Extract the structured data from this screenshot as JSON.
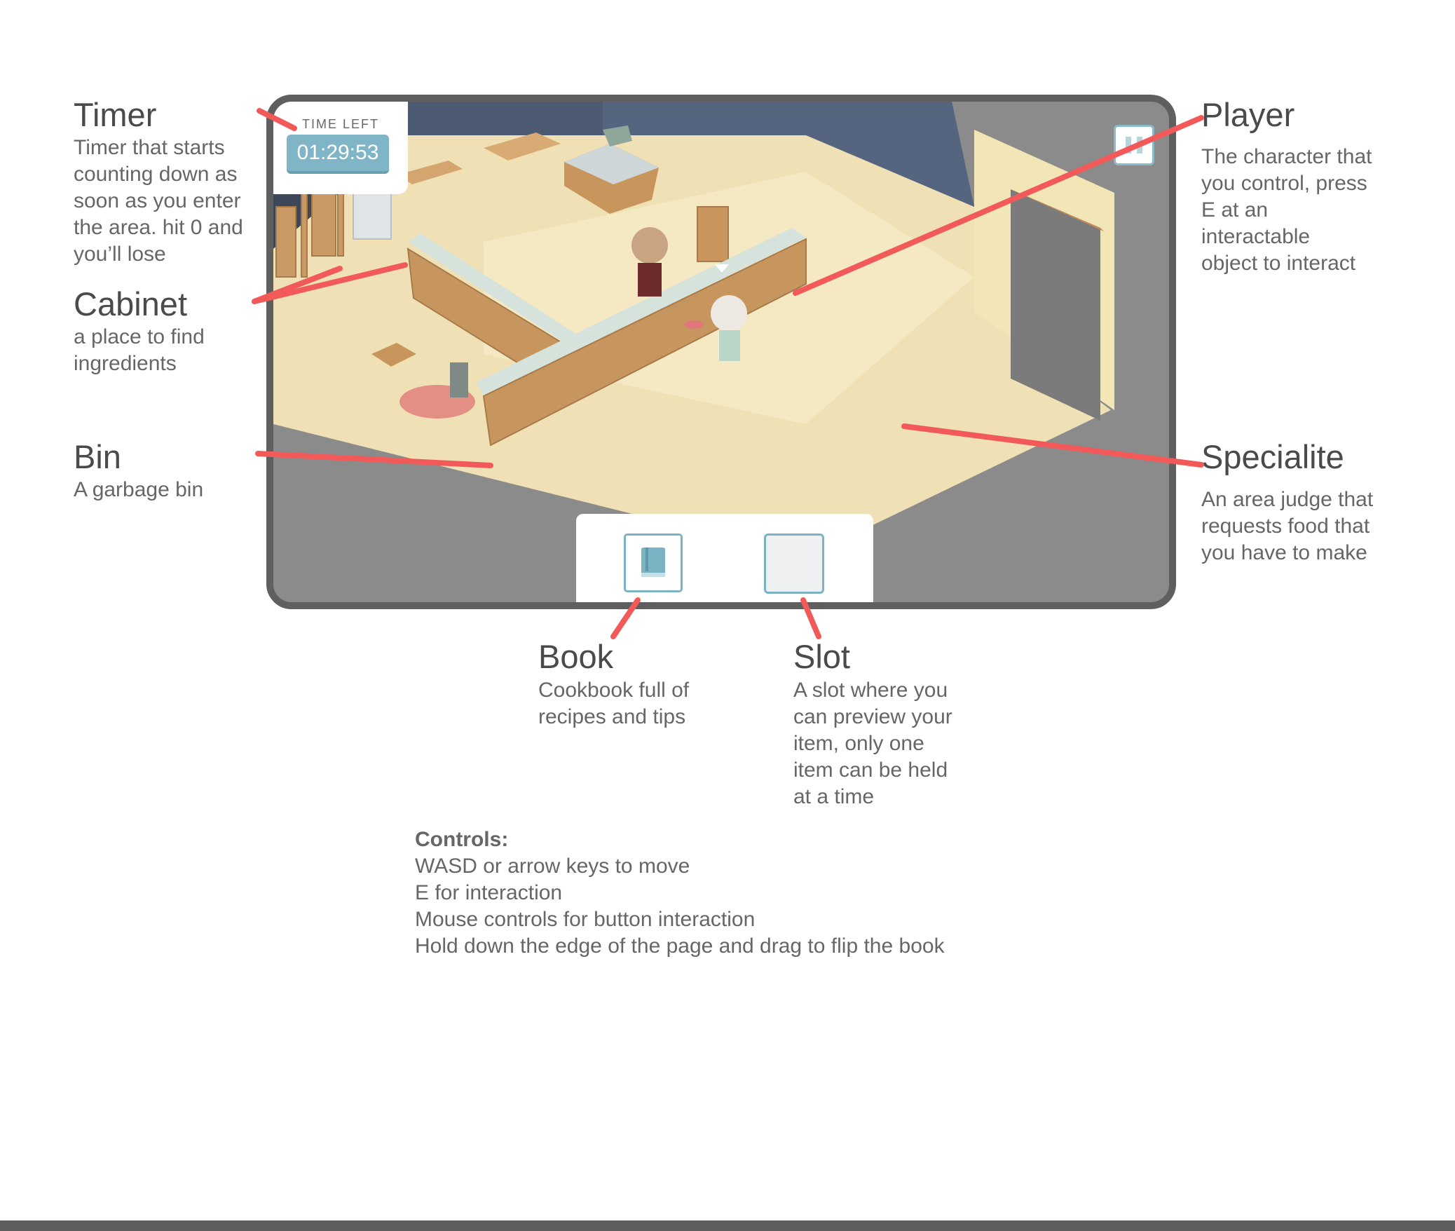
{
  "annotations": {
    "timer": {
      "title": "Timer",
      "desc": [
        "Timer that starts",
        "counting down as",
        "soon as you enter",
        "the area. hit 0 and",
        "you’ll lose"
      ]
    },
    "cabinet": {
      "title": "Cabinet",
      "desc": [
        "a place to find",
        "ingredients"
      ]
    },
    "bin": {
      "title": "Bin",
      "desc": [
        "A garbage bin"
      ]
    },
    "player": {
      "title": "Player",
      "desc": [
        "The character that",
        "you control, press",
        "E at an",
        "interactable",
        "object to interact"
      ]
    },
    "specialite": {
      "title": "Specialite",
      "desc": [
        "An area judge that",
        "requests food that",
        "you have to make"
      ]
    },
    "book": {
      "title": "Book",
      "desc": [
        "Cookbook full of",
        "recipes and tips"
      ]
    },
    "slot": {
      "title": "Slot",
      "desc": [
        "A slot where you",
        "can preview your",
        "item, only one",
        "item can be held",
        "at a time"
      ]
    }
  },
  "hud": {
    "timer_label": "TIME LEFT",
    "timer_value": "01:29:53",
    "pause_icon": "pause-icon",
    "book_icon": "book-icon"
  },
  "controls": {
    "title": "Controls:",
    "lines": [
      "WASD or arrow keys to move",
      "E for interaction",
      "Mouse controls for button interaction",
      "Hold down the edge of the page and drag to flip the book"
    ]
  },
  "colors": {
    "pointer": "#f25a5a",
    "hud_accent": "#7fb5c6",
    "frame": "#5f5f5f"
  }
}
